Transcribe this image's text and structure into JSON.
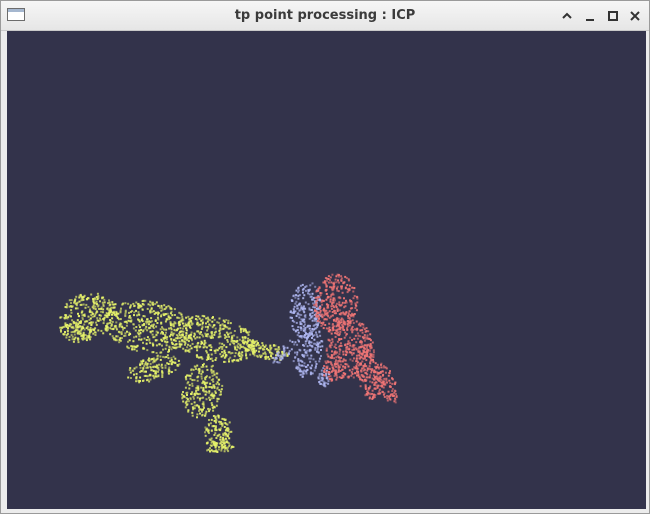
{
  "window": {
    "title": "tp point processing : ICP",
    "app_icon": "window-icon",
    "controls": [
      "shade-icon",
      "minimize-icon",
      "maximize-icon",
      "close-icon"
    ]
  },
  "viewport": {
    "background": "#33334b",
    "clouds": [
      {
        "id": "model",
        "color": "#e6f26a"
      },
      {
        "id": "target",
        "color": "#f07575"
      },
      {
        "id": "aligned",
        "color": "#aeb6f0"
      }
    ]
  }
}
